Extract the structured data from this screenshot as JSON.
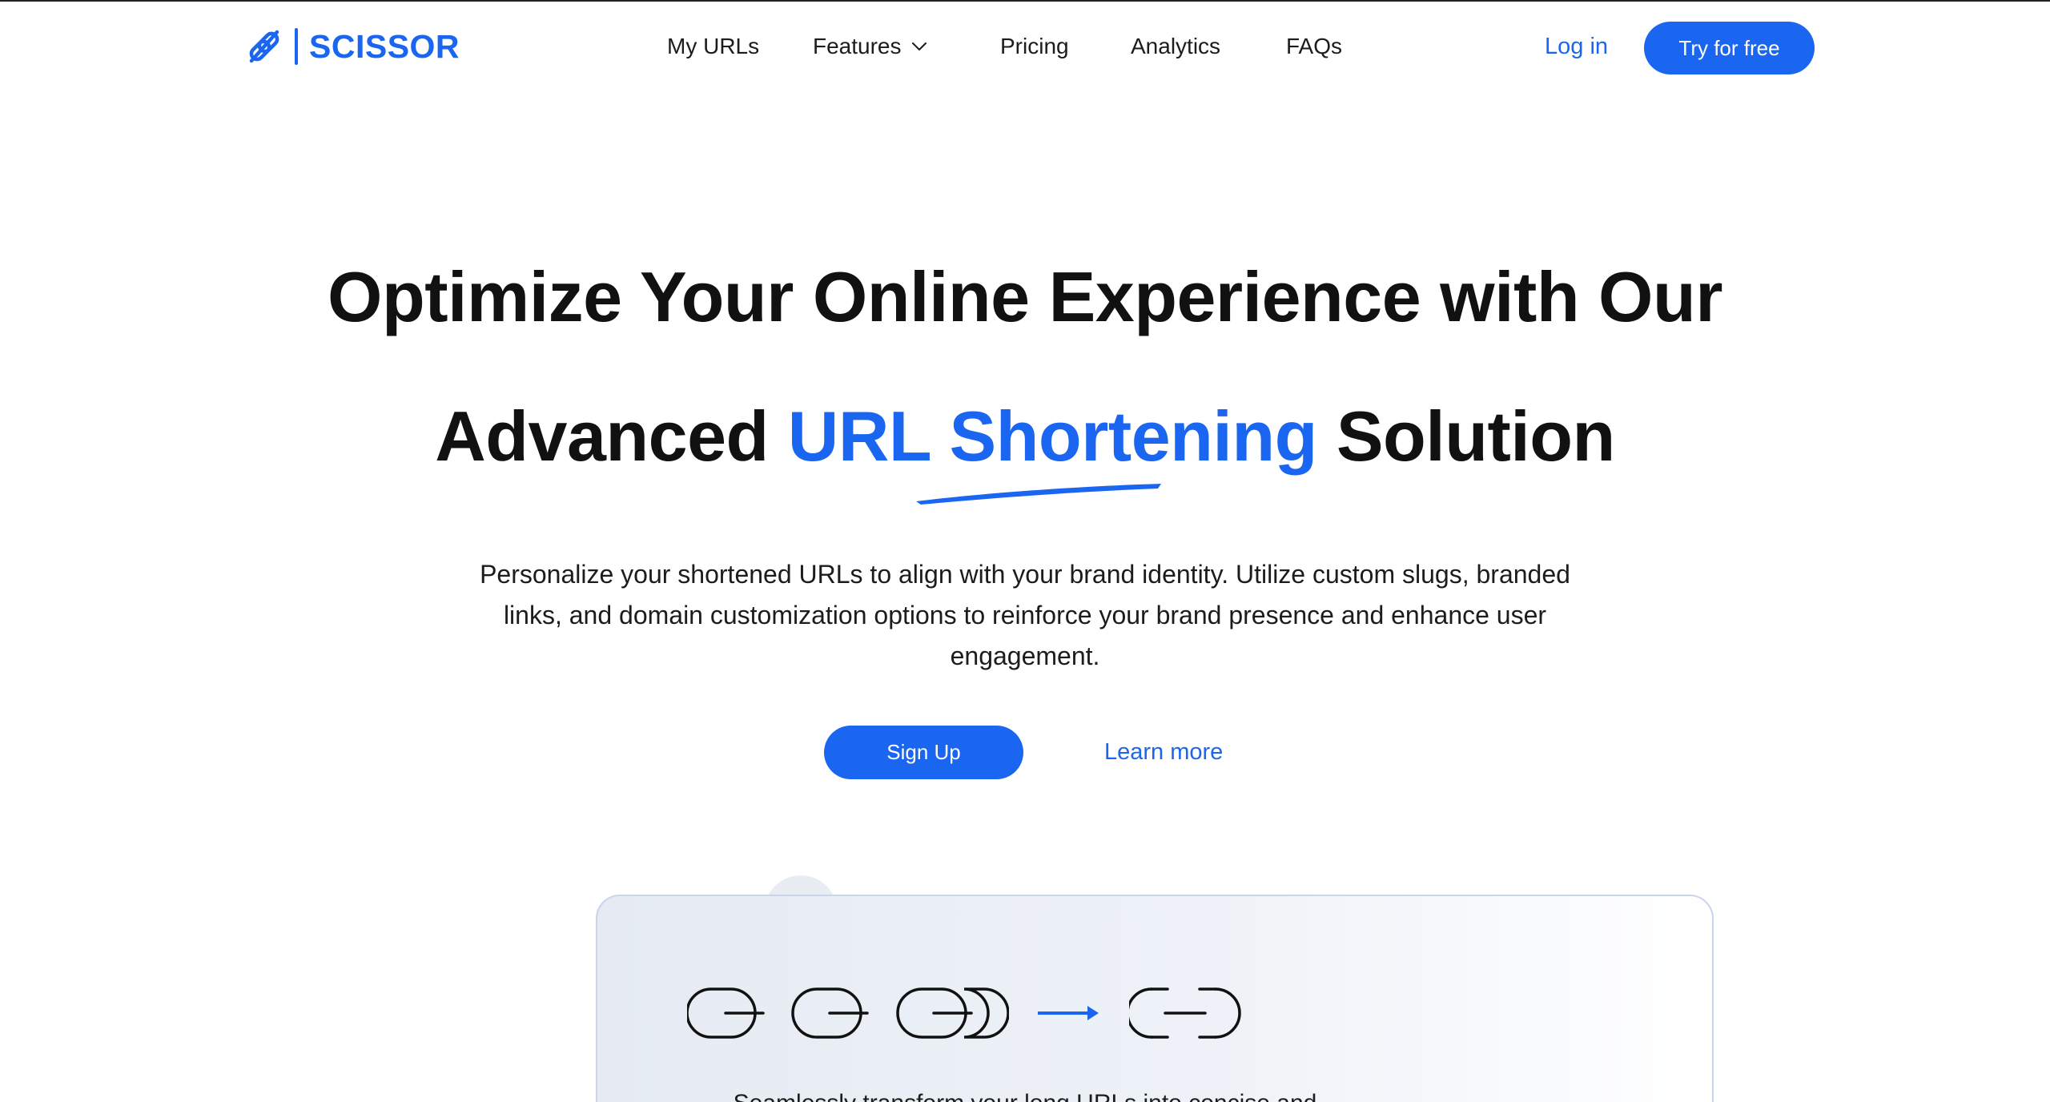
{
  "brand": {
    "name": "SCISSOR",
    "logo_icon": "link-cut-icon",
    "accent_color": "#1a66f0"
  },
  "nav": {
    "items": [
      {
        "label": "My URLs"
      },
      {
        "label": "Features",
        "icon": "chevron-down-icon"
      },
      {
        "label": "Pricing"
      },
      {
        "label": "Analytics"
      },
      {
        "label": "FAQs"
      }
    ],
    "login_label": "Log in",
    "cta_label": "Try for free"
  },
  "hero": {
    "line1": "Optimize Your Online Experience with Our",
    "line2_prefix": "Advanced ",
    "line2_accent": "URL Shortening",
    "line2_suffix": " Solution",
    "subtext": "Personalize your shortened URLs to align with your brand identity. Utilize custom slugs, branded links, and domain customization options to reinforce your brand presence and enhance user engagement.",
    "primary_button": "Sign Up",
    "secondary_link": "Learn more"
  },
  "preview": {
    "long_link_icon": "long-chain-link-icon",
    "arrow_icon": "arrow-right-icon",
    "short_link_icon": "short-chain-link-icon",
    "caption": "Seamlessly transform your long URLs into concise and"
  }
}
